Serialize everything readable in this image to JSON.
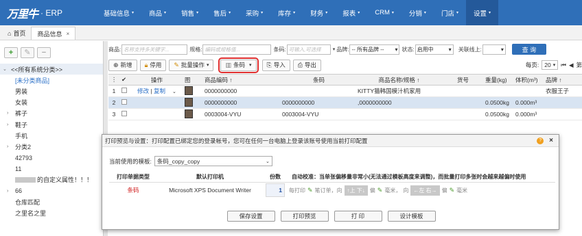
{
  "app": {
    "brand": "万里牛",
    "suffix": "· ERP"
  },
  "nav": {
    "items": [
      {
        "label": "基础信息",
        "active": false
      },
      {
        "label": "商品",
        "active": false
      },
      {
        "label": "销售",
        "active": false
      },
      {
        "label": "售后",
        "active": false
      },
      {
        "label": "采购",
        "active": false
      },
      {
        "label": "库存",
        "active": false
      },
      {
        "label": "财务",
        "active": false
      },
      {
        "label": "报表",
        "active": false
      },
      {
        "label": "CRM",
        "active": false
      },
      {
        "label": "分销",
        "active": false
      },
      {
        "label": "门店",
        "active": false
      },
      {
        "label": "设置",
        "active": true
      }
    ]
  },
  "tabs": [
    {
      "label": "首页",
      "icon": "home-icon",
      "closable": false
    },
    {
      "label": "商品信息",
      "closable": true,
      "close": "×"
    }
  ],
  "left": {
    "tools": {
      "add": "+",
      "edit": "✎",
      "remove": "−"
    },
    "tree": [
      {
        "label": "<<所有系统分类>>",
        "type": "root",
        "arrow": "⌄"
      },
      {
        "label": "[未分类商品]",
        "type": "link"
      },
      {
        "label": "男装",
        "type": "child"
      },
      {
        "label": "女装",
        "type": "child"
      },
      {
        "label": "裤子",
        "type": "haskid",
        "arrow": "›"
      },
      {
        "label": "鞋子",
        "type": "haskid",
        "arrow": "›"
      },
      {
        "label": "手机",
        "type": "child"
      },
      {
        "label": "分类2",
        "type": "haskid",
        "arrow": "›"
      },
      {
        "label": "42793",
        "type": "child"
      },
      {
        "label": "11",
        "type": "child"
      },
      {
        "label": "的自定义属性！！！",
        "type": "blurred"
      },
      {
        "label": "66",
        "type": "haskid",
        "arrow": "›"
      },
      {
        "label": "仓库匹配",
        "type": "child"
      },
      {
        "label": "之里名之里",
        "type": "child"
      }
    ]
  },
  "search": {
    "product_label": "商品:",
    "product_placeholder": "名称支持多关键字...",
    "spec_label": "规格:",
    "spec_placeholder": "编码或规格值...",
    "barcode_label": "条码:",
    "barcode_placeholder": "可输入,可选择",
    "brand_label": "品牌:",
    "brand_value": "-- 所有品牌 --",
    "status_label": "状态:",
    "status_value": "启用中",
    "online_label": "关联线上:",
    "online_value": "",
    "search_button": "查 询"
  },
  "toolbar": {
    "add": "新增",
    "disable": "停用",
    "batch": "批量操作",
    "barcode": "条码",
    "import": "导入",
    "export": "导出",
    "per_page_label": "每页:",
    "per_page_value": "20",
    "page_label": "第"
  },
  "grid": {
    "headers": {
      "op": "操作",
      "img": "图",
      "code": "商品编码 ↑",
      "barcode": "条码",
      "name": "商品名称/规格 ↑",
      "goods_no": "货号",
      "weight": "重量(kg)",
      "volume": "体积(m³)",
      "brand": "品牌 ↑"
    },
    "rows": [
      {
        "num": "1",
        "op_edit": "修改",
        "op_copy": "复制",
        "code": "0000000000",
        "barcode": "",
        "name": "KITTY猫韩国模汁机家用",
        "goods_no": "",
        "weight": "",
        "volume": "",
        "brand": "衣服王子"
      },
      {
        "num": "2",
        "code": "0000000000",
        "barcode": "0000000000",
        "name": ",0000000000",
        "goods_no": "",
        "weight": "0.0500kg",
        "volume": "0.000m³",
        "brand": ""
      },
      {
        "num": "3",
        "code": "0003004-VYU",
        "barcode": "0003004-VYU",
        "name": "",
        "goods_no": "",
        "weight": "0.0500kg",
        "volume": "0.000m³",
        "brand": ""
      }
    ]
  },
  "modal": {
    "title": "打印预览与设置：打印配置已绑定您的登录帐号，您可在任何一台电脑上登录该账号使用当前打印配置",
    "help": "?",
    "close": "×",
    "template_label": "当前使用的模板:",
    "template_value": "条码_copy_copy",
    "headers": {
      "type": "打印单据类型",
      "printer": "默认打印机",
      "copies": "份数",
      "auto": "自动校准：当单张偏移量非常小(无法通过模板高度来调整)，而批量打印多张时会越来越偏时使用"
    },
    "row": {
      "type": "条码",
      "printer": "Microsoft XPS Document Writer",
      "copies": "1",
      "every": "每打印",
      "per_label": "笔订单，向",
      "updown": "↑上 下↓",
      "offset1": "偏",
      "mm1": "毫米，",
      "dir2": "向",
      "leftright": "←左 右→",
      "offset2": "偏",
      "mm2": "毫米"
    },
    "buttons": {
      "save": "保存设置",
      "preview": "打印预览",
      "print": "打 印",
      "design": "设计模板"
    }
  }
}
